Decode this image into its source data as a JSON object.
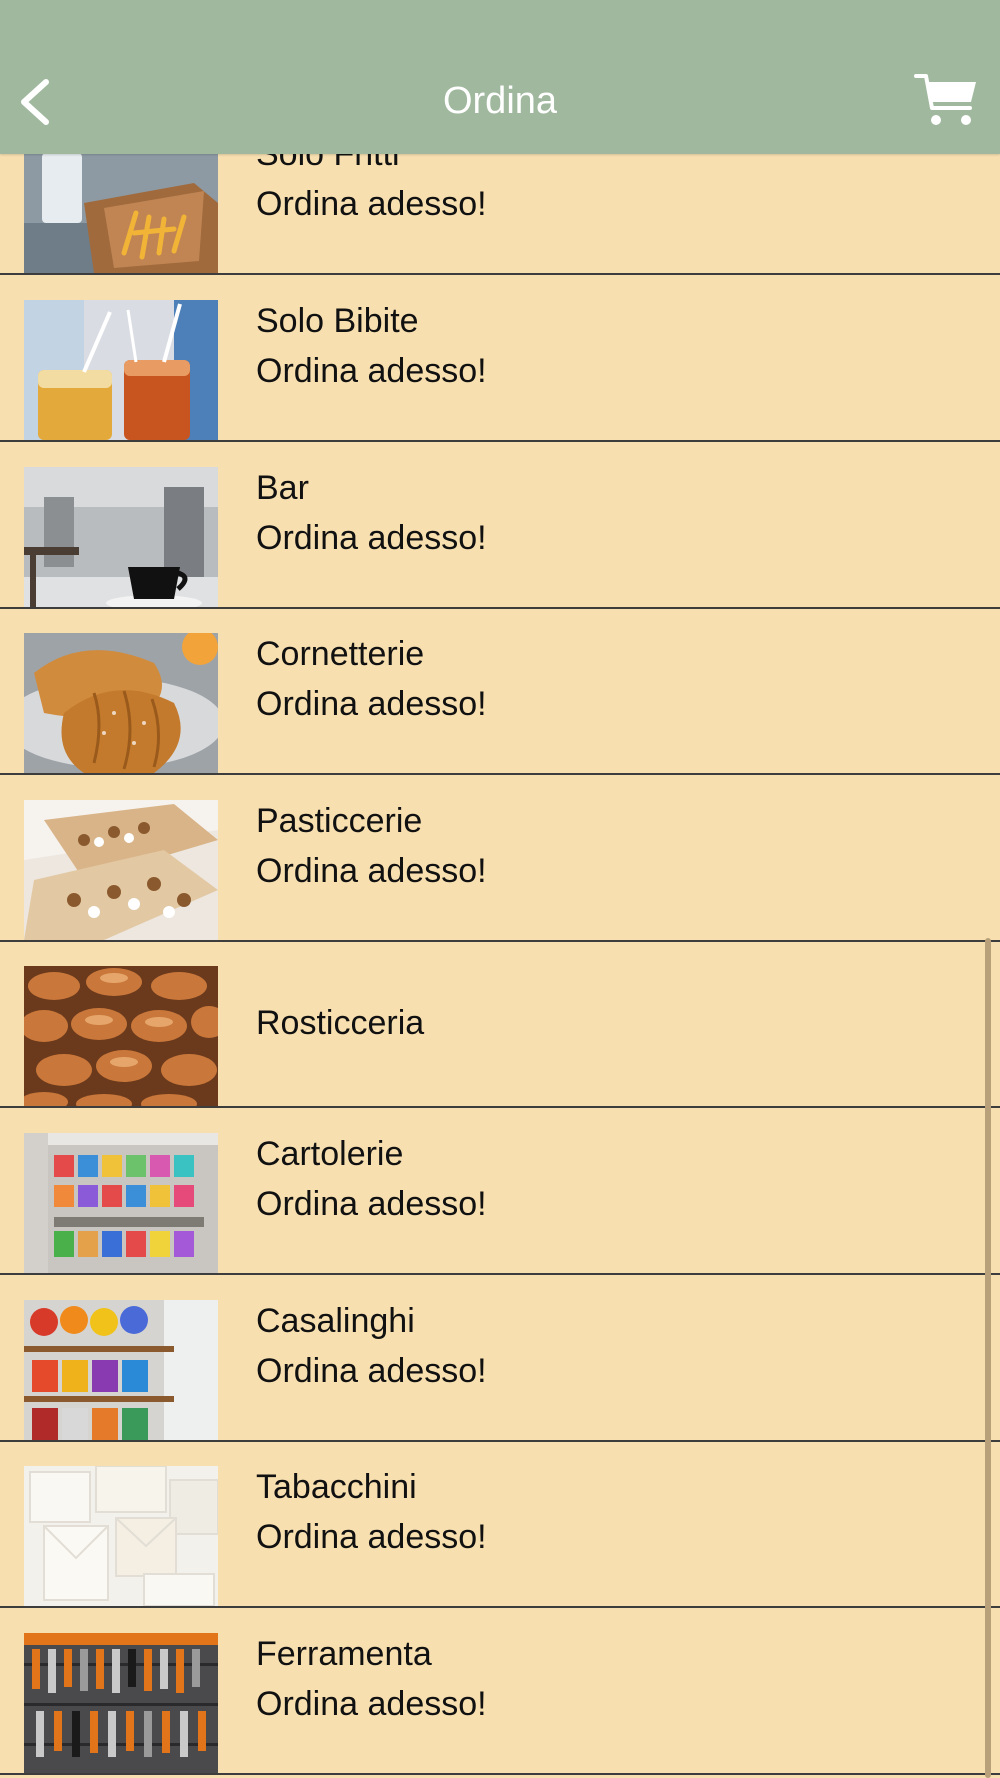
{
  "header": {
    "title": "Ordina",
    "back_icon": "chevron-left-icon",
    "cart_icon": "cart-icon"
  },
  "colors": {
    "header_bg": "#9fb89e",
    "list_bg": "#f7dfb0",
    "divider": "#3d3d3d"
  },
  "items": [
    {
      "name": "Solo Fritti",
      "subtitle": "Ordina adesso!"
    },
    {
      "name": "Solo Bibite",
      "subtitle": "Ordina adesso!"
    },
    {
      "name": "Bar",
      "subtitle": "Ordina adesso!"
    },
    {
      "name": "Cornetterie",
      "subtitle": "Ordina adesso!"
    },
    {
      "name": "Pasticcerie",
      "subtitle": "Ordina adesso!"
    },
    {
      "name": "Rosticceria",
      "subtitle": ""
    },
    {
      "name": "Cartolerie",
      "subtitle": "Ordina adesso!"
    },
    {
      "name": "Casalinghi",
      "subtitle": "Ordina adesso!"
    },
    {
      "name": "Tabacchini",
      "subtitle": "Ordina adesso!"
    },
    {
      "name": "Ferramenta",
      "subtitle": "Ordina adesso!"
    }
  ]
}
